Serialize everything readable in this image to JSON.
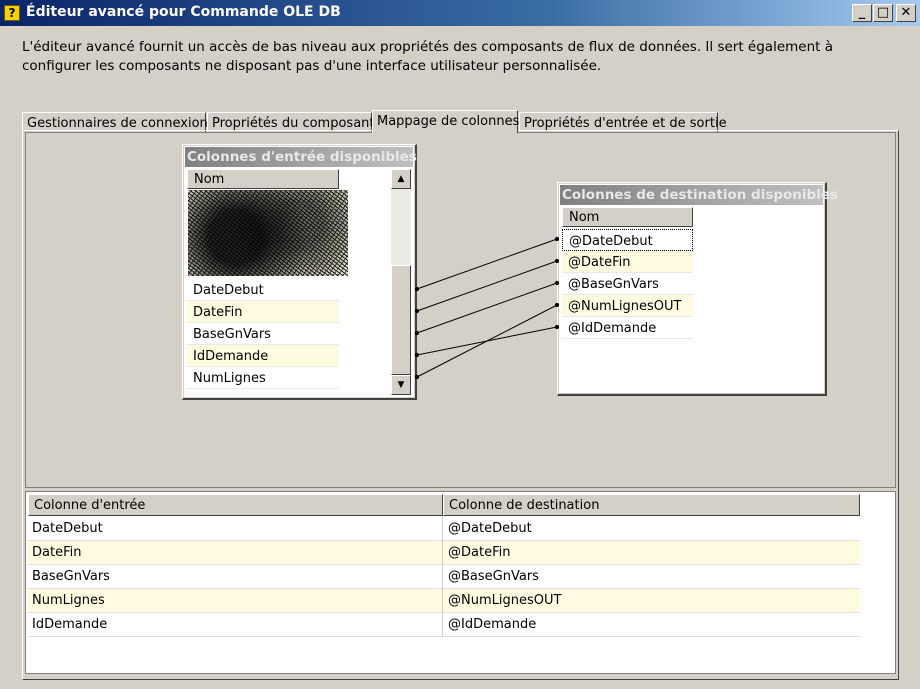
{
  "window": {
    "title": "Éditeur avancé pour Commande OLE DB",
    "minimize": "_",
    "maximize": "□",
    "close": "✕"
  },
  "description": "L'éditeur avancé fournit un accès de bas niveau aux propriétés des composants de flux de données. Il sert également à configurer les composants ne disposant pas d'une interface utilisateur personnalisée.",
  "tabs": [
    {
      "label": "Gestionnaires de connexions",
      "active": false
    },
    {
      "label": "Propriétés du composant",
      "active": false
    },
    {
      "label": "Mappage de colonnes",
      "active": true
    },
    {
      "label": "Propriétés d'entrée et de sortie",
      "active": false
    }
  ],
  "input_box": {
    "title": "Colonnes d'entrée disponibles",
    "column_header": "Nom",
    "rows": [
      "DateDebut",
      "DateFin",
      "BaseGnVars",
      "IdDemande",
      "NumLignes"
    ]
  },
  "dest_box": {
    "title": "Colonnes de destination disponibles",
    "column_header": "Nom",
    "rows": [
      "@DateDebut",
      "@DateFin",
      "@BaseGnVars",
      "@NumLignesOUT",
      "@IdDemande"
    ]
  },
  "mapping_grid": {
    "headers": [
      "Colonne d'entrée",
      "Colonne de destination"
    ],
    "rows": [
      [
        "DateDebut",
        "@DateDebut"
      ],
      [
        "DateFin",
        "@DateFin"
      ],
      [
        "BaseGnVars",
        "@BaseGnVars"
      ],
      [
        "NumLignes",
        "@NumLignesOUT"
      ],
      [
        "IdDemande",
        "@IdDemande"
      ]
    ]
  },
  "icons": {
    "app": "help-question-icon",
    "scroll_up": "arrow-up-icon",
    "scroll_down": "arrow-down-icon"
  },
  "colors": {
    "titlebar_start": "#0a246a",
    "titlebar_end": "#a6caf0",
    "alt_row": "#fefbe0",
    "face": "#d4d0c8"
  }
}
